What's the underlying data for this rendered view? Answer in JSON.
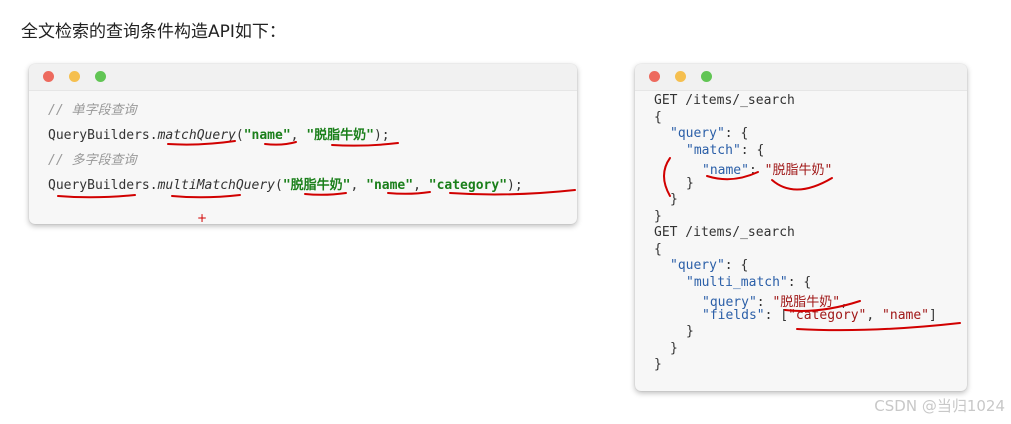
{
  "heading": "全文检索的查询条件构造API如下：",
  "window_dots": {
    "red": "#ed6a5e",
    "yellow": "#f5bf4f",
    "green": "#61c554"
  },
  "left_code": {
    "comment1": "// 单字段查询",
    "l1_obj": "QueryBuilders.",
    "l1_method": "matchQuery",
    "l1_open": "(",
    "l1_arg1": "\"name\"",
    "l1_sep": ", ",
    "l1_arg2": "\"脱脂牛奶\"",
    "l1_close": ");",
    "comment2": "// 多字段查询",
    "l2_obj": "QueryBuilders.",
    "l2_method": "multiMatchQuery",
    "l2_open": "(",
    "l2_arg1": "\"脱脂牛奶\"",
    "l2_sep1": ", ",
    "l2_arg2": "\"name\"",
    "l2_sep2": ", ",
    "l2_arg3": "\"category\"",
    "l2_close": ");",
    "plus_mark": "+"
  },
  "right_code": {
    "r1": "GET /items/_search",
    "r2": "{",
    "r3_key": "\"query\"",
    "r3_rest": ": {",
    "r4_key": "\"match\"",
    "r4_rest": ": {",
    "r5_key": "\"name\"",
    "r5_colon": ": ",
    "r5_val": "\"脱脂牛奶\"",
    "r6": "}",
    "r7": "}",
    "r8": "}",
    "r9": "GET /items/_search",
    "r10": "{",
    "r11_key": "\"query\"",
    "r11_rest": ": {",
    "r12_key": "\"multi_match\"",
    "r12_rest": ": {",
    "r13_key": "\"query\"",
    "r13_colon": ": ",
    "r13_val": "\"脱脂牛奶\"",
    "r13_comma": ",",
    "r14_key": "\"fields\"",
    "r14_colon": ": [",
    "r14_val1": "\"category\"",
    "r14_sep": ", ",
    "r14_val2": "\"name\"",
    "r14_close": "]",
    "r15": "}",
    "r16": "}",
    "r17": "}"
  },
  "watermark": "CSDN @当归1024"
}
